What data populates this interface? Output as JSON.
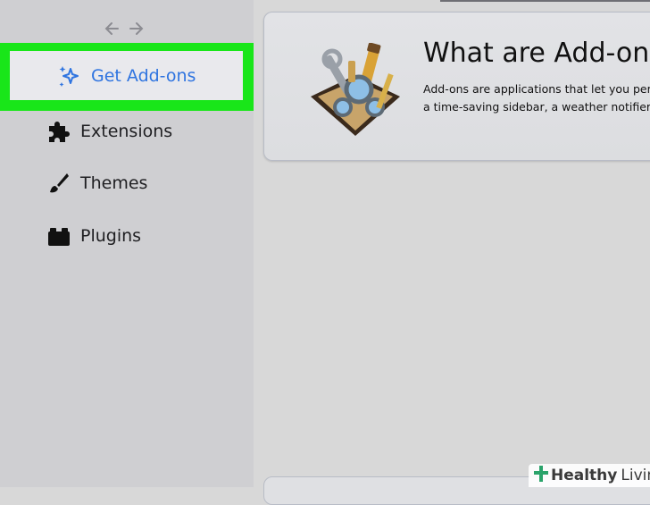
{
  "sidebar": {
    "items": [
      {
        "label": "Get Add-ons",
        "icon": "sparkle-icon",
        "active": true
      },
      {
        "label": "Extensions",
        "icon": "puzzle-piece-icon"
      },
      {
        "label": "Themes",
        "icon": "paintbrush-icon"
      },
      {
        "label": "Plugins",
        "icon": "plugin-block-icon"
      }
    ],
    "accent": "#2f74e0",
    "highlight": "#19e619"
  },
  "card": {
    "title": "What are Add-ons?",
    "line1": "Add-ons are applications that let you perso",
    "line2": "a time-saving sidebar, a weather notifier, o"
  },
  "watermark": {
    "brand": "Healthy",
    "brand2": "Living"
  }
}
